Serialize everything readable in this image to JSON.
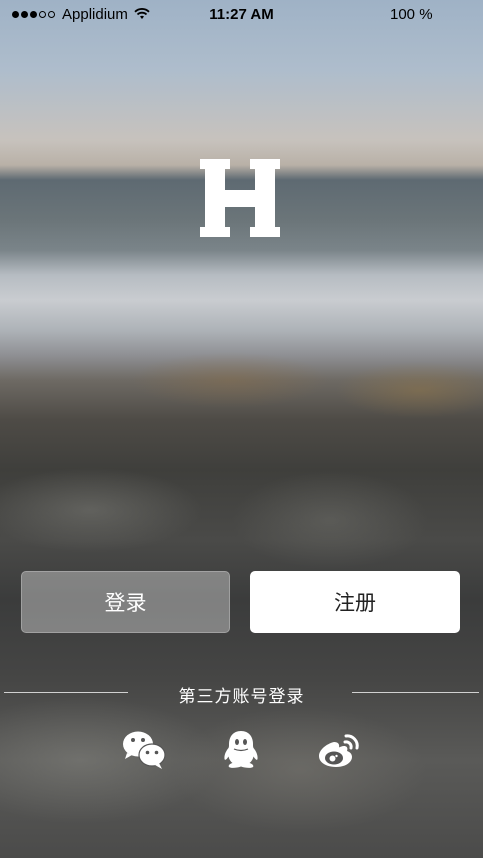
{
  "status_bar": {
    "carrier": "Applidium",
    "time": "11:27 AM",
    "battery": "100 %",
    "signal_icon": "signal-dots-icon",
    "wifi_icon": "wifi-icon"
  },
  "logo": {
    "letter": "H"
  },
  "buttons": {
    "login_label": "登录",
    "register_label": "注册"
  },
  "third_party": {
    "label": "第三方账号登录",
    "providers": [
      "wechat-icon",
      "qq-icon",
      "weibo-icon"
    ]
  },
  "colors": {
    "login_bg": "rgba(255,255,255,0.35)",
    "register_bg": "#ffffff",
    "text_light": "#ffffff"
  }
}
